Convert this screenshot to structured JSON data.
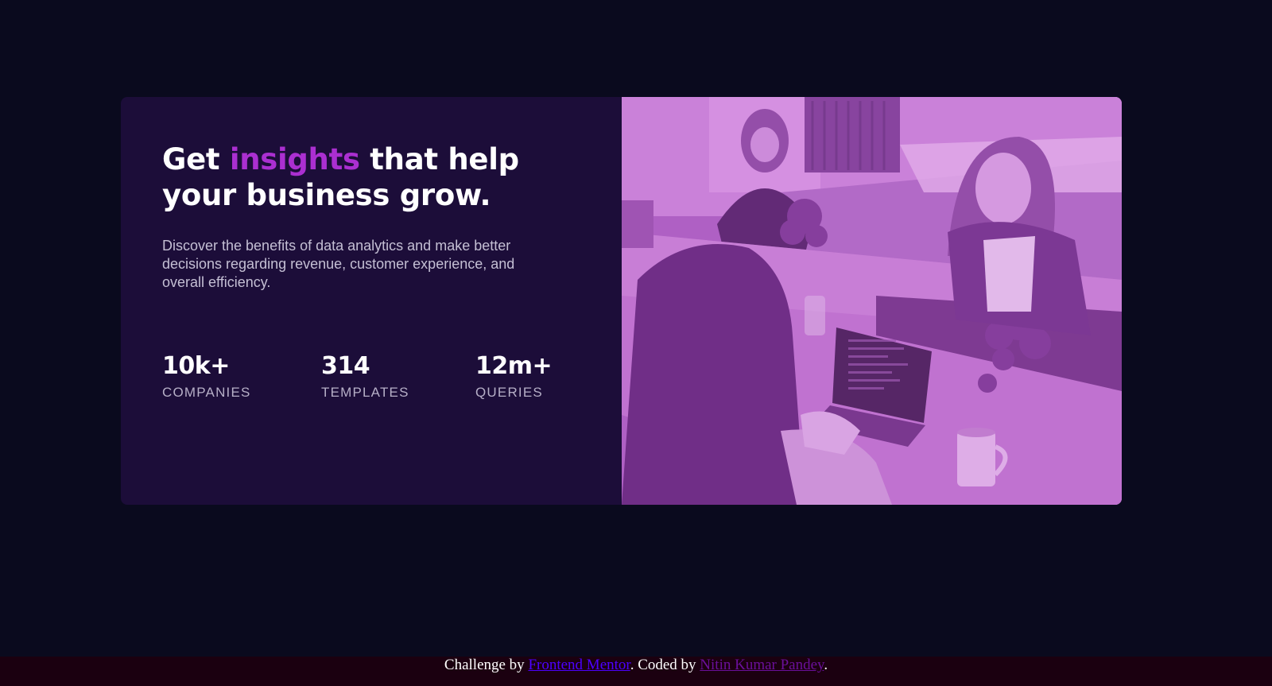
{
  "card": {
    "headline_before": "Get ",
    "headline_accent": "insights",
    "headline_after": " that help your business grow.",
    "description": "Discover the benefits of data analytics and make better decisions regarding revenue, customer experience, and overall efficiency.",
    "stats": [
      {
        "value": "10k+",
        "label": "COMPANIES"
      },
      {
        "value": "314",
        "label": "TEMPLATES"
      },
      {
        "value": "12m+",
        "label": "QUERIES"
      }
    ],
    "image_alt": "Three women working at a shared table with laptops"
  },
  "colors": {
    "page_background": "#0a0a1e",
    "card_background": "#1c0d39",
    "accent": "#ab2fd1",
    "image_tint": "#aa5cc3"
  },
  "footer": {
    "prefix": "Challenge by ",
    "mentor_link": "Frontend Mentor",
    "middle": ". Coded by ",
    "author_link": "Nitin Kumar Pandey",
    "suffix": "."
  }
}
